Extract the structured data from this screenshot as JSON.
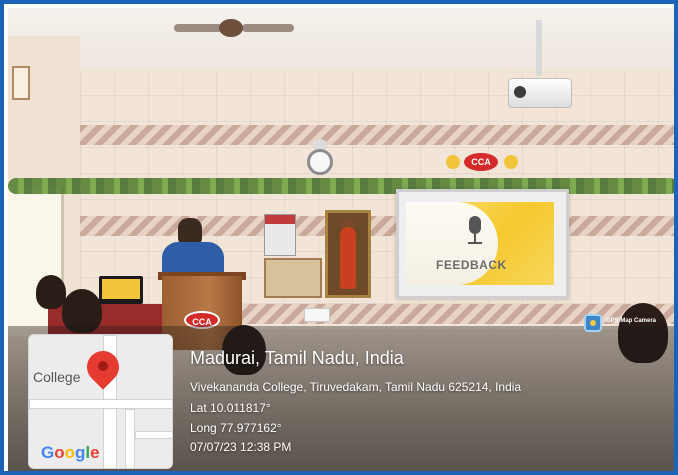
{
  "scene": {
    "slide_text": "FEEDBACK",
    "podium_badge": "CCA",
    "wall_sign": "CCA"
  },
  "gps_app": {
    "name": "GPS Map Camera"
  },
  "map": {
    "place_label": "College",
    "provider": "Google",
    "provider_letters": [
      "G",
      "o",
      "o",
      "g",
      "l",
      "e"
    ],
    "provider_colors": [
      "#4285f4",
      "#ea4335",
      "#fbbc05",
      "#4285f4",
      "#34a853",
      "#ea4335"
    ]
  },
  "location": {
    "title": "Madurai, Tamil Nadu, India",
    "address": "Vivekananda College, Tiruvedakam, Tamil Nadu 625214, India",
    "lat": "Lat 10.011817°",
    "long": "Long 77.977162°",
    "datetime": "07/07/23 12:38 PM"
  },
  "colors": {
    "frame_border": "#1b63b8",
    "pin": "#e53b30",
    "badge_red": "#d42a2a"
  }
}
